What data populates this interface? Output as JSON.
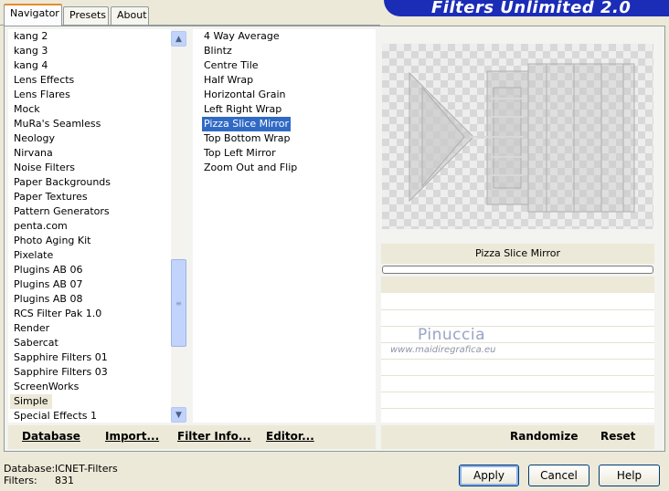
{
  "banner": {
    "title": "Filters Unlimited 2.0"
  },
  "tabs": [
    {
      "label": "Navigator",
      "active": true
    },
    {
      "label": "Presets",
      "active": false
    },
    {
      "label": "About",
      "active": false
    }
  ],
  "categories": [
    "kang 2",
    "kang 3",
    "kang 4",
    "Lens Effects",
    "Lens Flares",
    "Mock",
    "MuRa's Seamless",
    "Neology",
    "Nirvana",
    "Noise Filters",
    "Paper Backgrounds",
    "Paper Textures",
    "Pattern Generators",
    "penta.com",
    "Photo Aging Kit",
    "Pixelate",
    "Plugins AB 06",
    "Plugins AB 07",
    "Plugins AB 08",
    "RCS Filter Pak 1.0",
    "Render",
    "Sabercat",
    "Sapphire Filters 01",
    "Sapphire Filters 03",
    "ScreenWorks",
    "Simple",
    "Special Effects 1"
  ],
  "selected_category": "Simple",
  "filters": [
    "4 Way Average",
    "Blintz",
    "Centre Tile",
    "Half Wrap",
    "Horizontal Grain",
    "Left Right Wrap",
    "Pizza Slice Mirror",
    "Top Bottom Wrap",
    "Top Left Mirror",
    "Zoom Out and Flip"
  ],
  "selected_filter": "Pizza Slice Mirror",
  "preview": {
    "filter_name": "Pizza Slice Mirror"
  },
  "watermark": {
    "name": "Pinuccia",
    "url": "www.maidiregrafica.eu"
  },
  "toolbar": {
    "database": "Database",
    "import": "Import...",
    "filter_info": "Filter Info...",
    "editor": "Editor...",
    "randomize": "Randomize",
    "reset": "Reset"
  },
  "status": {
    "database_label": "Database:",
    "database_value": "ICNET-Filters",
    "filters_label": "Filters:",
    "filters_value": "831"
  },
  "buttons": {
    "apply": "Apply",
    "cancel": "Cancel",
    "help": "Help"
  },
  "icons": {
    "scroll_up": "chevron-up-icon",
    "scroll_down": "chevron-down-icon",
    "thumb_grip": "grip-icon"
  },
  "colors": {
    "selection": "#316ac5",
    "banner": "#1b2cb7",
    "active_tab_accent": "#e68b2c"
  }
}
